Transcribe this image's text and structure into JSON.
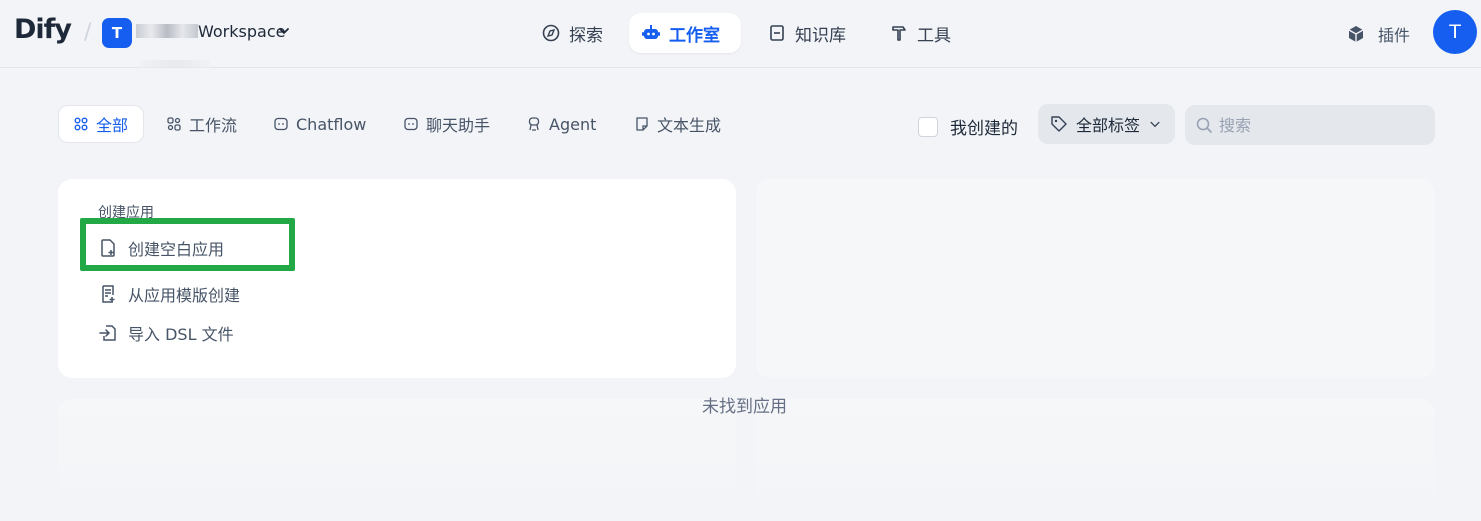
{
  "header": {
    "logo": "Dify",
    "workspace": {
      "avatar_letter": "T",
      "name_suffix": "Workspace"
    },
    "nav": [
      {
        "label": "探索",
        "icon": "compass-icon"
      },
      {
        "label": "工作室",
        "icon": "robot-icon",
        "active": true
      },
      {
        "label": "知识库",
        "icon": "book-icon"
      },
      {
        "label": "工具",
        "icon": "hammer-icon"
      }
    ],
    "plugins_label": "插件",
    "user_avatar_letter": "T"
  },
  "filters": {
    "tabs": [
      {
        "label": "全部",
        "active": true
      },
      {
        "label": "工作流"
      },
      {
        "label": "Chatflow"
      },
      {
        "label": "聊天助手"
      },
      {
        "label": "Agent"
      },
      {
        "label": "文本生成"
      }
    ],
    "created_by_me_label": "我创建的",
    "tags_label": "全部标签",
    "search_placeholder": "搜索"
  },
  "create_card": {
    "title": "创建应用",
    "items": [
      {
        "label": "创建空白应用",
        "icon": "blank-file-icon"
      },
      {
        "label": "从应用模版创建",
        "icon": "template-file-icon"
      },
      {
        "label": "导入 DSL 文件",
        "icon": "import-icon"
      }
    ]
  },
  "empty_message": "未找到应用",
  "colors": {
    "accent": "#155eef",
    "highlight": "#22a844",
    "background": "#f2f4f7"
  }
}
